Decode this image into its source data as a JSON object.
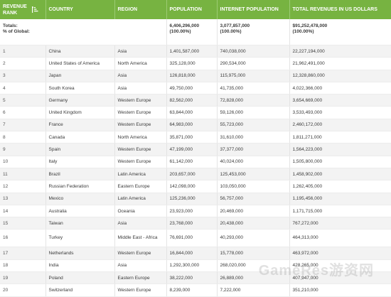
{
  "headers": {
    "rank": "Revenue Rank",
    "country": "Country",
    "region": "Region",
    "population": "Population",
    "internet": "Internet Population",
    "revenue": "Total Revenues in US Dollars"
  },
  "totals": {
    "label_line1": "Totals:",
    "label_line2": "% of Global:",
    "population": "6,406,296,000",
    "population_pct": "(100.00%)",
    "internet": "3,077,857,000",
    "internet_pct": "(100.00%)",
    "revenue": "$91,252,478,000",
    "revenue_pct": "(100.00%)"
  },
  "rows": [
    {
      "rank": "1",
      "country": "China",
      "region": "Asia",
      "population": "1,401,587,000",
      "internet": "740,038,000",
      "revenue": "22,227,194,000"
    },
    {
      "rank": "2",
      "country": "United States of America",
      "region": "North America",
      "population": "325,128,000",
      "internet": "290,534,000",
      "revenue": "21,962,491,000"
    },
    {
      "rank": "3",
      "country": "Japan",
      "region": "Asia",
      "population": "126,818,000",
      "internet": "115,975,000",
      "revenue": "12,328,860,000"
    },
    {
      "rank": "4",
      "country": "South Korea",
      "region": "Asia",
      "population": "49,750,000",
      "internet": "41,735,000",
      "revenue": "4,022,366,000"
    },
    {
      "rank": "5",
      "country": "Germany",
      "region": "Western Europe",
      "population": "82,562,000",
      "internet": "72,828,000",
      "revenue": "3,654,669,000"
    },
    {
      "rank": "6",
      "country": "United Kingdom",
      "region": "Western Europe",
      "population": "63,844,000",
      "internet": "59,126,000",
      "revenue": "3,533,493,000"
    },
    {
      "rank": "7",
      "country": "France",
      "region": "Western Europe",
      "population": "64,983,000",
      "internet": "55,723,000",
      "revenue": "2,460,172,000"
    },
    {
      "rank": "8",
      "country": "Canada",
      "region": "North America",
      "population": "35,871,000",
      "internet": "31,610,000",
      "revenue": "1,811,271,000"
    },
    {
      "rank": "9",
      "country": "Spain",
      "region": "Western Europe",
      "population": "47,199,000",
      "internet": "37,377,000",
      "revenue": "1,564,223,000"
    },
    {
      "rank": "10",
      "country": "Italy",
      "region": "Western Europe",
      "population": "61,142,000",
      "internet": "40,024,000",
      "revenue": "1,505,800,000"
    },
    {
      "rank": "11",
      "country": "Brazil",
      "region": "Latin America",
      "population": "203,657,000",
      "internet": "125,453,000",
      "revenue": "1,458,902,000"
    },
    {
      "rank": "12",
      "country": "Russian Federation",
      "region": "Eastern Europe",
      "population": "142,098,000",
      "internet": "103,050,000",
      "revenue": "1,262,405,000"
    },
    {
      "rank": "13",
      "country": "Mexico",
      "region": "Latin America",
      "population": "125,236,000",
      "internet": "56,757,000",
      "revenue": "1,195,456,000"
    },
    {
      "rank": "14",
      "country": "Australia",
      "region": "Oceania",
      "population": "23,923,000",
      "internet": "20,469,000",
      "revenue": "1,171,715,000"
    },
    {
      "rank": "15",
      "country": "Taiwan",
      "region": "Asia",
      "population": "23,768,000",
      "internet": "20,438,000",
      "revenue": "767,272,000"
    },
    {
      "rank": "16",
      "country": "Turkey",
      "region": "Middle East - Africa",
      "population": "76,691,000",
      "internet": "40,293,000",
      "revenue": "464,313,000"
    },
    {
      "rank": "17",
      "country": "Netherlands",
      "region": "Western Europe",
      "population": "16,844,000",
      "internet": "15,778,000",
      "revenue": "463,972,000"
    },
    {
      "rank": "18",
      "country": "India",
      "region": "Asia",
      "population": "1,292,300,000",
      "internet": "268,020,000",
      "revenue": "428,265,000"
    },
    {
      "rank": "19",
      "country": "Poland",
      "region": "Eastern Europe",
      "population": "38,222,000",
      "internet": "26,889,000",
      "revenue": "407,947,000"
    },
    {
      "rank": "20",
      "country": "Switzerland",
      "region": "Western Europe",
      "population": "8,239,000",
      "internet": "7,222,000",
      "revenue": "351,210,000"
    }
  ],
  "watermark": "GameRes游资网",
  "colors": {
    "header_bg": "#77b341",
    "stripe": "#f3f3f3"
  },
  "icons": {
    "sort": "sort-ascending-icon"
  }
}
